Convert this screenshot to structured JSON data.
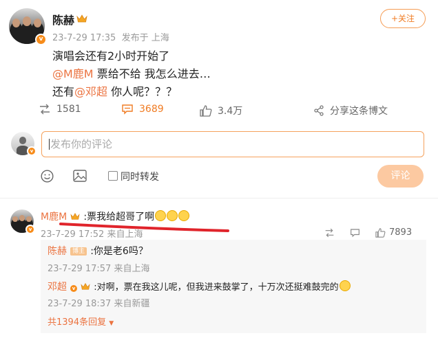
{
  "post": {
    "author": "陈赫",
    "time": "23-7-29 17:35",
    "source": "发布于 上海",
    "follow_label": "+关注",
    "lines": {
      "line1": "演唱会还有2小时开始了",
      "line2_mention": "@M鹿M",
      "line2_text": " 票给不给 我怎么进去…",
      "line3_prefix": "还有",
      "line3_mention": "@邓超",
      "line3_suffix": " 你人呢？？？"
    },
    "stats": {
      "repost": "1581",
      "comment": "3689",
      "like": "3.4万",
      "share": "分享这条博文"
    }
  },
  "composer": {
    "placeholder": "发布你的评论",
    "repost_option": "同时转发",
    "submit": "评论"
  },
  "comment": {
    "author": "M鹿M",
    "text": ":票我给超哥了啊",
    "time": "23-7-29 17:52",
    "source": "来自上海",
    "likes": "7893",
    "replies": [
      {
        "author": "陈赫",
        "tag": "博主",
        "text": ":你是老6吗？",
        "time": "23-7-29 17:57",
        "source": "来自上海"
      },
      {
        "author": "邓超",
        "text": ":对啊，票在我这儿呢，但我进来鼓掌了，十万次还挺难鼓完的",
        "time": "23-7-29 18:37",
        "source": "来自新疆"
      }
    ],
    "more_replies": "共1394条回复"
  },
  "colors": {
    "accent": "#f07b22",
    "mention": "#eb7340",
    "underline": "#e0242b"
  }
}
